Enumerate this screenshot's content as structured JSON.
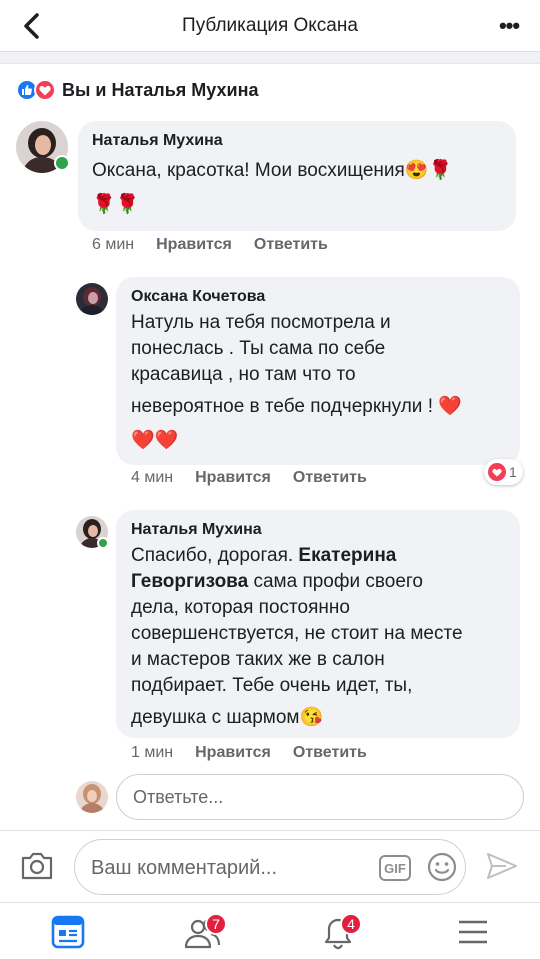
{
  "header": {
    "title": "Публикация Оксана",
    "back_icon": "chevron-left-icon",
    "more_icon": "more-dots-icon",
    "more_glyph": "•••"
  },
  "likes": {
    "text": "Вы и Наталья Мухина",
    "icons": [
      "like-icon",
      "love-icon"
    ]
  },
  "comments": [
    {
      "author": "Наталья Мухина",
      "line1": "Оксана, красотка! Мои восхищения😍🌹",
      "line2": "🌹🌹",
      "time": "6 мин",
      "like_label": "Нравится",
      "reply_label": "Ответить"
    },
    {
      "author": "Оксана Кочетова",
      "lines": [
        "Натуль на тебя посмотрела и",
        "понеслась . Ты сама по себе",
        "красавица , но там что то",
        "невероятное в тебе подчеркнули ! ❤️",
        "❤️❤️"
      ],
      "time": "4 мин",
      "like_label": "Нравится",
      "reply_label": "Ответить",
      "reaction_count": "1"
    },
    {
      "author": "Наталья Мухина",
      "line1": "Спасибо, дорогая. ",
      "mention_a": "Екатерина",
      "mention_b": "Геворгизова",
      "line2_rest": " сама профи своего",
      "line3": "дела, которая постоянно",
      "line4": "совершенствуется, не стоит на месте",
      "line5": "и мастеров таких же в салон",
      "line6": "подбирает. Тебе очень идет, ты,",
      "line7": "девушка с шармом😘",
      "time": "1 мин",
      "like_label": "Нравится",
      "reply_label": "Ответить"
    }
  ],
  "reply_box": {
    "placeholder": "Ответьте..."
  },
  "composer": {
    "placeholder": "Ваш комментарий...",
    "gif_label": "GIF",
    "icons": [
      "camera-icon",
      "gif-icon",
      "emoji-icon",
      "send-icon"
    ]
  },
  "bottom_nav": {
    "items": [
      "news-feed-icon",
      "friends-icon",
      "notifications-icon",
      "menu-icon"
    ],
    "friends_badge": "7",
    "notifications_badge": "4"
  },
  "colors": {
    "accent": "#1877f2",
    "love": "#f33e58",
    "badge": "#e41e3f",
    "online": "#31a24c",
    "bubble": "#f0f2f5"
  }
}
